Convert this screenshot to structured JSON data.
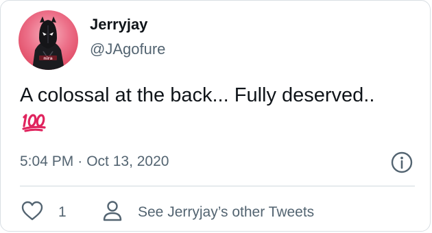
{
  "tweet": {
    "display_name": "Jerryjay",
    "handle": "@JAgofure",
    "text": "A colossal at the back... Fully deserved.. ",
    "emoji": "hundred-points-icon",
    "time": "5:04 PM",
    "separator": "·",
    "date": "Oct 13, 2020",
    "like_count": "1",
    "other_tweets_label": "See Jerryjay’s other Tweets"
  },
  "colors": {
    "text_primary": "#0f1419",
    "text_secondary": "#536471",
    "divider": "#cfd9de",
    "border": "#d8dee3",
    "emoji_red": "#e0245e",
    "avatar_bg": "#ec6f88"
  },
  "icons": {
    "info": "info-circle-icon",
    "like": "heart-outline-icon",
    "profile": "person-outline-icon"
  }
}
